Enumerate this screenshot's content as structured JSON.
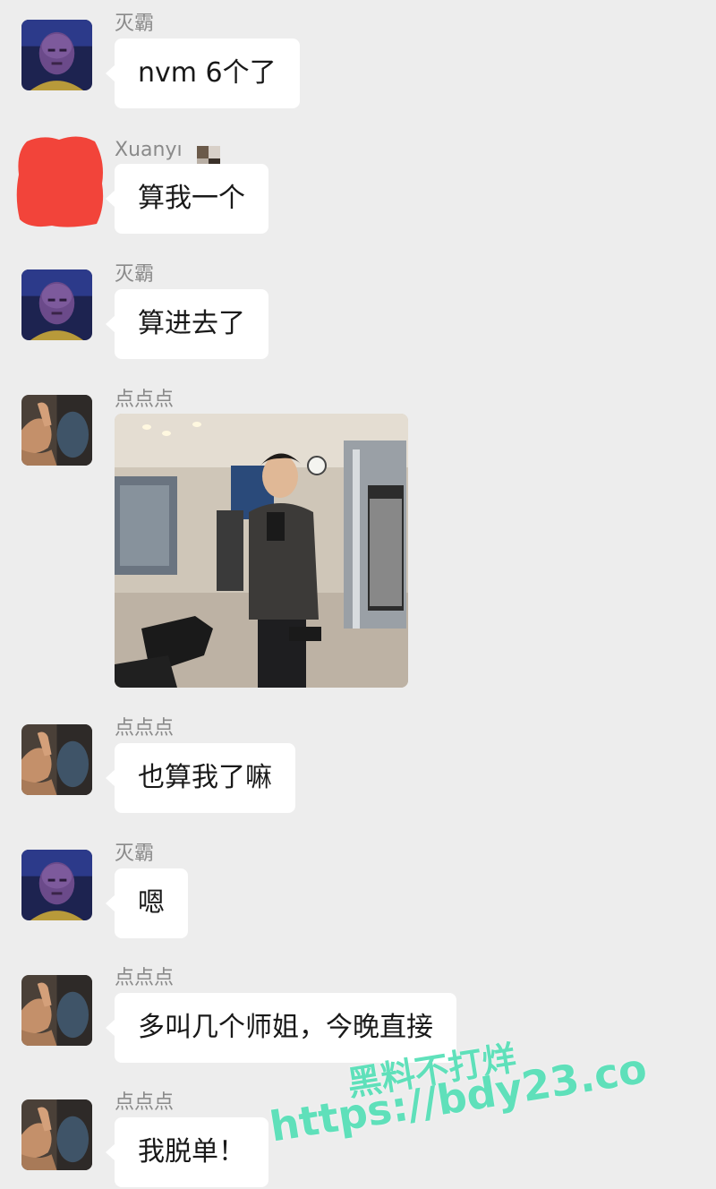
{
  "messages": [
    {
      "sender": "灭霸",
      "avatar": "thanos-avatar",
      "text": "nvm 6个了"
    },
    {
      "sender": "Xuanyı",
      "avatar": "redacted-avatar",
      "text": "算我一个"
    },
    {
      "sender": "灭霸",
      "avatar": "thanos-avatar",
      "text": "算进去了"
    },
    {
      "sender": "点点点",
      "avatar": "hand-dumbbell-avatar",
      "image": "gym-mirror-selfie-photo"
    },
    {
      "sender": "点点点",
      "avatar": "hand-dumbbell-avatar",
      "text": "也算我了嘛"
    },
    {
      "sender": "灭霸",
      "avatar": "thanos-avatar",
      "text": "嗯"
    },
    {
      "sender": "点点点",
      "avatar": "hand-dumbbell-avatar",
      "text": "多叫几个师姐，今晚直接"
    },
    {
      "sender": "点点点",
      "avatar": "hand-dumbbell-avatar",
      "text": "我脱单！"
    }
  ],
  "watermark": {
    "line1": "黑料不打烊",
    "line2": "https://bdy23.co",
    "color": "#58e0b8"
  },
  "colors": {
    "background": "#ededed",
    "bubble": "#ffffff",
    "sender_name": "#8a8a8a",
    "redaction": "#f2443a"
  }
}
